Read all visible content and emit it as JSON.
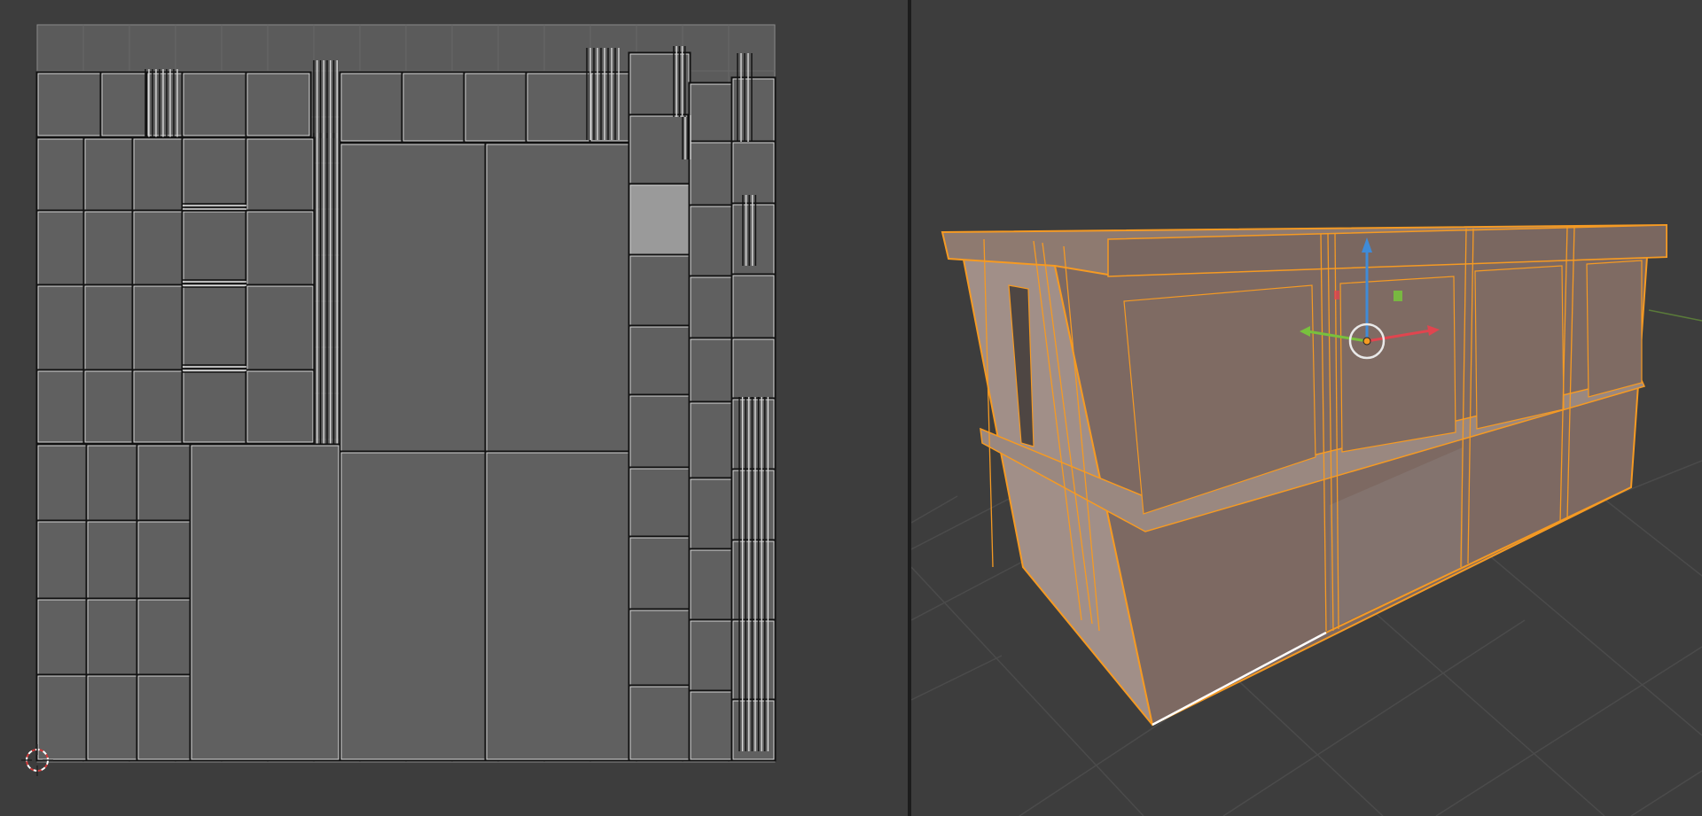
{
  "uv_editor": {
    "colors": {
      "area_bg": "#3d3d3d",
      "uv_grid_bg": "#5b5b5b",
      "uv_face_fill": "#606060",
      "uv_selected_face": "#9a9a9a",
      "uv_edge_outer": "#111111",
      "uv_edge_inner": "#d8d8d8",
      "cursor": "#d43a3a"
    },
    "icons": [
      "2d-cursor-icon"
    ]
  },
  "viewport_3d": {
    "colors": {
      "area_bg": "#3d3d3d",
      "floor_grid": "#4c4c4c",
      "selection_outline": "#f59a23",
      "face_top": "#8e7a70",
      "face_front": "#7d6962",
      "face_side": "#a18f88",
      "axis_x": "#e0454f",
      "axis_y": "#78c13d",
      "axis_z": "#3f8bd8"
    },
    "icons": [
      "transform-gizmo-icon",
      "object-origin-icon"
    ]
  }
}
